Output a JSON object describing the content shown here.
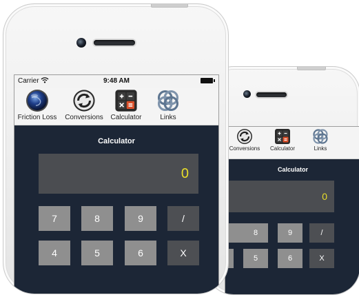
{
  "status": {
    "carrier": "Carrier",
    "time": "9:48 AM"
  },
  "tabs": [
    {
      "label": "Friction Loss",
      "icon": "globe-icon"
    },
    {
      "label": "Conversions",
      "icon": "refresh-icon"
    },
    {
      "label": "Calculator",
      "icon": "calculator-icon"
    },
    {
      "label": "Links",
      "icon": "chain-links-icon"
    }
  ],
  "calculator": {
    "title": "Calculator",
    "display": "0",
    "keys_row1": [
      "7",
      "8",
      "9",
      "/"
    ],
    "keys_row2": [
      "4",
      "5",
      "6",
      "X"
    ]
  },
  "colors": {
    "screen_bg": "#1c2636",
    "display_bg": "#4b4d51",
    "display_text": "#e8de2a",
    "number_key": "#8f8f8f",
    "operator_key": "#4d4f53"
  }
}
